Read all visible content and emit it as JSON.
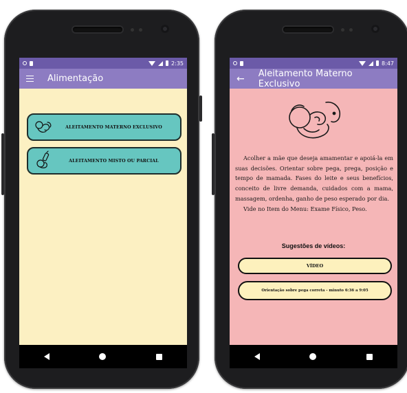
{
  "left_screen": {
    "status_time": "2:35",
    "app_title": "Alimentação",
    "buttons": [
      {
        "label": "ALEITAMENTO MATERNO EXCLUSIVO",
        "icon": "breastfeeding-baby-icon"
      },
      {
        "label": "ALEITAMENTO MISTO OU PARCIAL",
        "icon": "bottle-feeding-icon"
      }
    ],
    "colors": {
      "background": "#fcf0c2",
      "button": "#66c6c0",
      "appbar": "#8d7cc2",
      "statusbar": "#6b5aa8"
    }
  },
  "right_screen": {
    "status_time": "8:47",
    "app_title": "Aleitamento Materno Exclusivo",
    "description": "Acolher a mãe que deseja amamentar e apoiá-la em suas decisões. Orientar sobre pega, prega, posição e tempo de mamada. Fases do leite e seus benefícios, conceito de livre demanda, cuidados com a mama, massagem, ordenha, ganho de peso esperado por dia.",
    "reference": "Vide no Item do Menu: Exame Físico, Peso.",
    "suggestions_title": "Sugestões de vídeos:",
    "video_buttons": [
      {
        "label": "VÍDEO"
      },
      {
        "label": "Orientação sobre pega correta - minuto 6:36 a 9:05"
      }
    ],
    "colors": {
      "background": "#f5b6b7",
      "button": "#fdf1bd"
    }
  }
}
